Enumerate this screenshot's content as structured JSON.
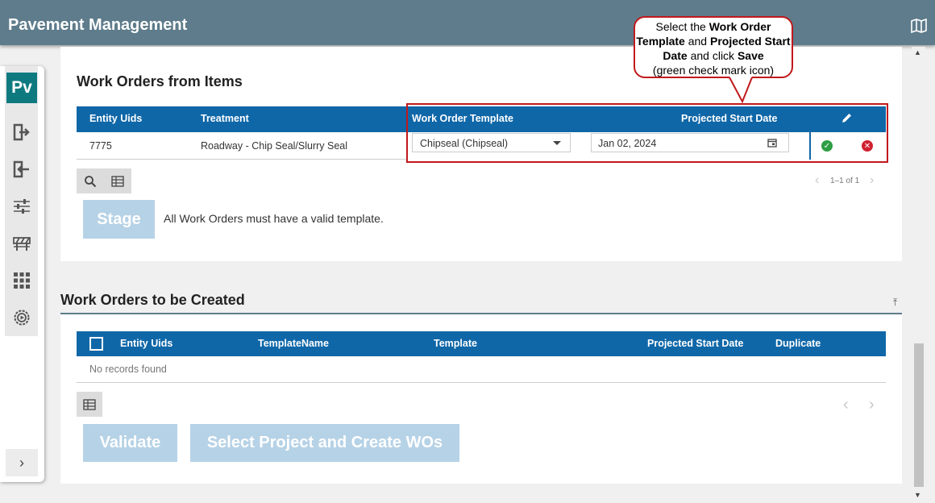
{
  "app": {
    "title": "Pavement Management",
    "map_icon": "map-icon"
  },
  "sidebar": {
    "logo": "Pv",
    "icons": [
      "import-icon",
      "export-icon",
      "sliders-icon",
      "barricade-icon",
      "grid-icon",
      "settings-icon"
    ],
    "expand": "›"
  },
  "section1": {
    "title": "Work Orders from Items",
    "columns": {
      "entity_uids": "Entity Uids",
      "treatment": "Treatment",
      "template": "Work Order Template",
      "start_date": "Projected Start Date"
    },
    "row": {
      "entity_uids": "7775",
      "treatment": "Roadway - Chip Seal/Slurry Seal",
      "template": "Chipseal (Chipseal)",
      "start_date": "Jan 02, 2024"
    },
    "pager": "1–1 of 1",
    "stage_label": "Stage",
    "message": "All Work Orders must have a valid template."
  },
  "section2": {
    "title": "Work Orders to be Created",
    "columns": {
      "entity_uids": "Entity Uids",
      "template_name": "TemplateName",
      "template": "Template",
      "start_date": "Projected Start Date",
      "duplicate": "Duplicate"
    },
    "empty": "No records found",
    "validate_label": "Validate",
    "create_label": "Select Project and Create WOs"
  },
  "callout": {
    "t1": "Select the ",
    "b1": "Work Order Template",
    "t2": " and ",
    "b2": "Projected Start Date",
    "t3": " and click ",
    "b3": "Save",
    "t4": "(green check mark icon)"
  },
  "colors": {
    "header": "#5e7c8b",
    "table_header": "#0f67a8",
    "save": "#2e9e44",
    "cancel": "#d02130",
    "disabled_button": "#b6d2e6"
  }
}
